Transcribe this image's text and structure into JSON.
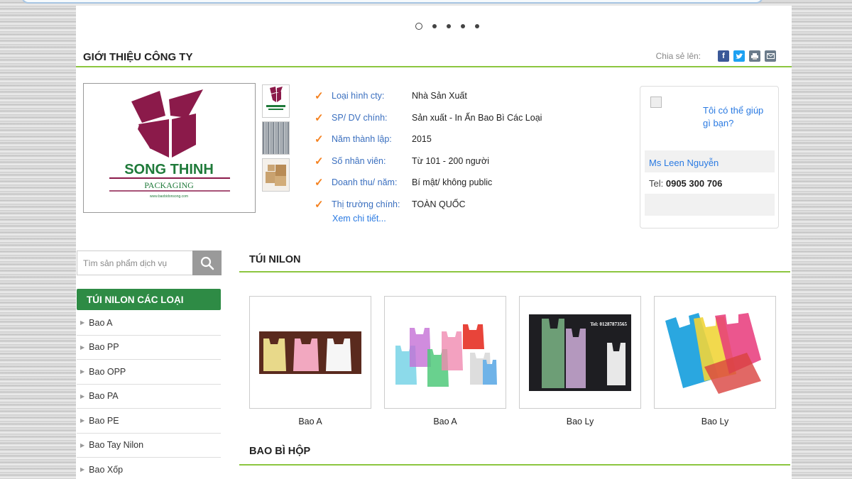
{
  "slider": {
    "dot_count": 5,
    "active_index": 0
  },
  "company_section": {
    "title": "GIỚI THIỆU CÔNG TY",
    "share_label": "Chia sẻ lên:",
    "share_icons": [
      "facebook-icon",
      "twitter-icon",
      "print-icon",
      "email-icon"
    ]
  },
  "logo": {
    "brand": "SONG THINH",
    "sub": "PACKAGING",
    "url": "www.baobidonsong.com"
  },
  "info": [
    {
      "label": "Loại hình cty:",
      "value": "Nhà Sản Xuất"
    },
    {
      "label": "SP/ DV chính:",
      "value": "Sản xuất - In Ấn Bao Bì Các Loại"
    },
    {
      "label": "Năm thành lập:",
      "value": "2015"
    },
    {
      "label": "Số nhân viên:",
      "value": "Từ 101 - 200 người"
    },
    {
      "label": "Doanh thu/ năm:",
      "value": "Bí mật/ không public"
    },
    {
      "label": "Thị trường chính:",
      "value": "TOÀN QUỐC"
    }
  ],
  "more_link": "Xem chi tiết...",
  "support": {
    "question": "Tôi có thể giúp gì bạn?",
    "name": "Ms Leen Nguyễn",
    "tel_label": "Tel:",
    "tel_value": "0905 300 706"
  },
  "search": {
    "placeholder": "Tìm sản phẩm dịch vụ"
  },
  "sidebar": {
    "title": "TÚI NILON CÁC LOẠI",
    "items": [
      {
        "label": "Bao A"
      },
      {
        "label": "Bao PP"
      },
      {
        "label": "Bao OPP"
      },
      {
        "label": "Bao PA"
      },
      {
        "label": "Bao PE"
      },
      {
        "label": "Bao Tay Nilon"
      },
      {
        "label": "Bao Xốp"
      }
    ]
  },
  "products_section": {
    "title": "TÚI NILON",
    "items": [
      {
        "name": "Bao A"
      },
      {
        "name": "Bao A"
      },
      {
        "name": "Bao Ly",
        "overlay_text": "Tel: 01287873565"
      },
      {
        "name": "Bao Ly"
      }
    ]
  },
  "box_section": {
    "title": "BAO BÌ HỘP"
  },
  "colors": {
    "accent_green": "#8cc63f",
    "sidebar_green": "#2e8b45",
    "check_orange": "#f58220",
    "link_blue": "#2a7ae2",
    "logo_maroon": "#8b1a4a"
  }
}
